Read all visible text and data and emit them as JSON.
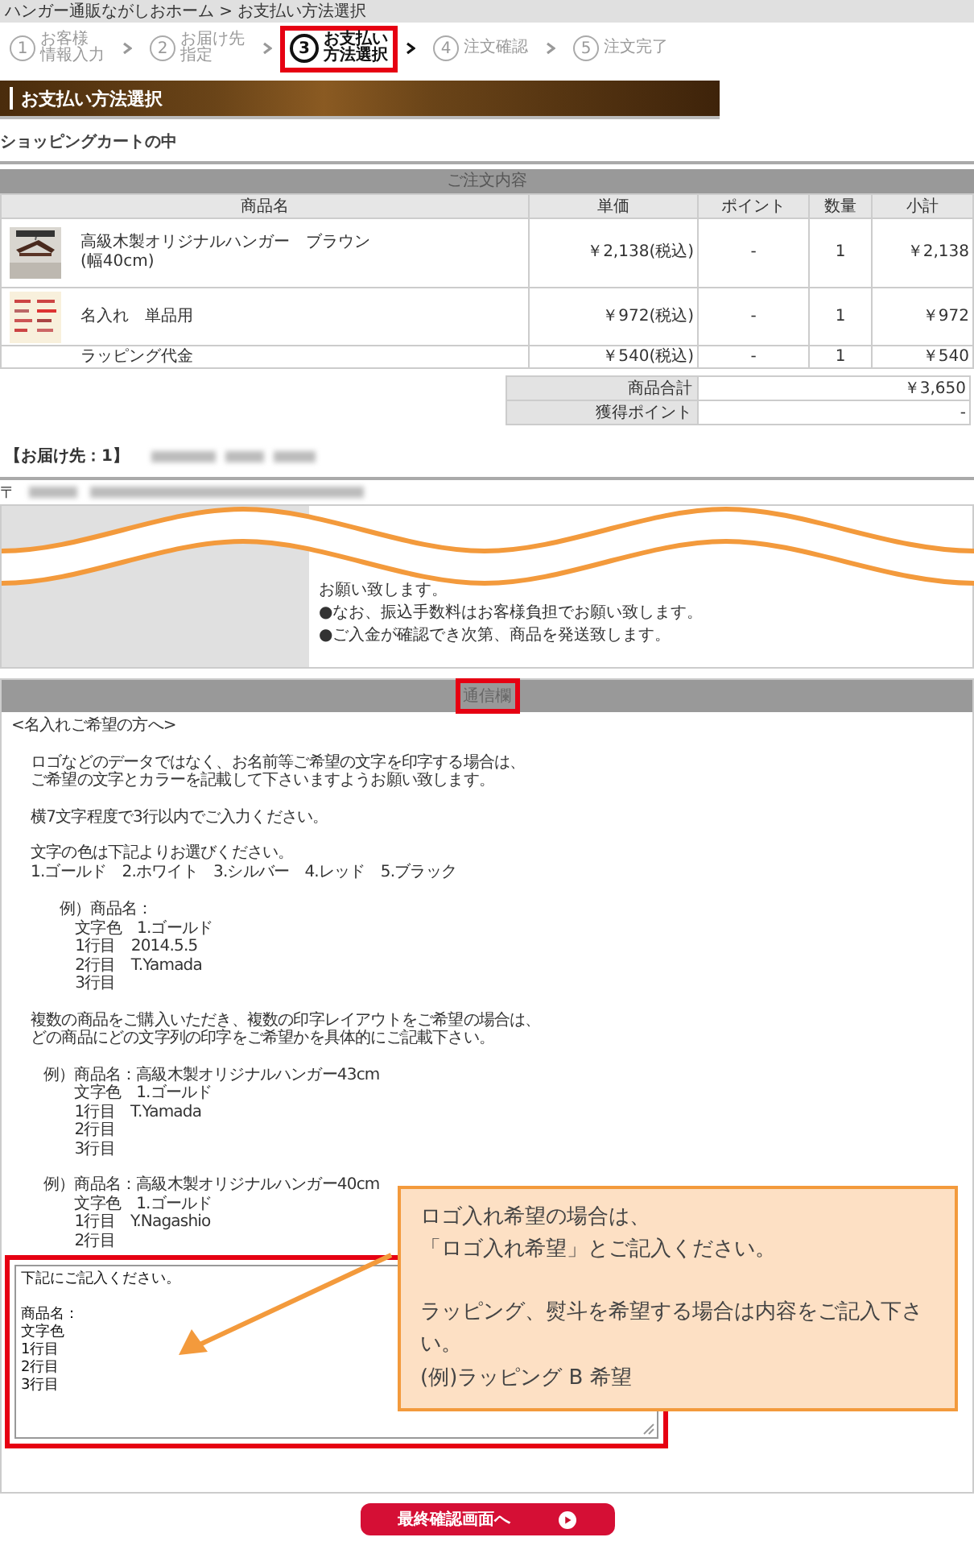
{
  "breadcrumb": "ハンガー通販ながしおホーム > お支払い方法選択",
  "steps": [
    {
      "num": "1",
      "lines": [
        "お客様",
        "情報入力"
      ],
      "selected": false
    },
    {
      "num": "2",
      "lines": [
        "お届け先",
        "指定"
      ],
      "selected": false
    },
    {
      "num": "3",
      "lines": [
        "お支払い",
        "方法選択"
      ],
      "selected": true
    },
    {
      "num": "4",
      "lines": [
        "注文確認"
      ],
      "selected": false
    },
    {
      "num": "5",
      "lines": [
        "注文完了"
      ],
      "selected": false
    }
  ],
  "page_heading": "お支払い方法選択",
  "cart_title": "ショッピングカートの中",
  "order": {
    "caption": "ご注文内容",
    "columns": [
      "商品名",
      "単価",
      "ポイント",
      "数量",
      "小計"
    ],
    "rows": [
      {
        "name": "高級木製オリジナルハンガー　ブラウン",
        "note": "(幅40cm)",
        "price": "￥2,138(税込)",
        "points": "-",
        "qty": "1",
        "subtotal": "￥2,138"
      },
      {
        "kind": "sample",
        "name": "名入れ　単品用",
        "price": "￥972(税込)",
        "points": "-",
        "qty": "1",
        "subtotal": "￥972"
      },
      {
        "kind": "plain",
        "name": "ラッピング代金",
        "price": "￥540(税込)",
        "points": "-",
        "qty": "1",
        "subtotal": "￥540"
      }
    ],
    "summary": [
      {
        "label": "商品合計",
        "value": "￥3,650"
      },
      {
        "label": "獲得ポイント",
        "value": "-"
      }
    ]
  },
  "delivery": {
    "label": "【お届け先：1】",
    "postal_mark": "〒"
  },
  "payment_notes": [
    "お願い致します。",
    "●なお、振込手数料はお客様負担でお願い致します。",
    "●ご入金が確認でき次第、商品を発送致します。"
  ],
  "message": {
    "caption": "通信欄",
    "caption_highlighted": true,
    "paragraphs": [
      {
        "kind": "title",
        "lines": [
          "<名入れご希望の方へ>"
        ]
      },
      {
        "kind": "body",
        "lines": [
          "ロゴなどのデータではなく、お名前等ご希望の文字を印字する場合は、",
          "ご希望の文字とカラーを記載して下さいますようお願い致します。"
        ]
      },
      {
        "kind": "body",
        "lines": [
          "横7文字程度で3行以内でご入力ください。"
        ]
      },
      {
        "kind": "body",
        "lines": [
          "文字の色は下記よりお選びください。",
          "1.ゴールド　2.ホワイト　3.シルバー　4.レッド　5.ブラック"
        ]
      },
      {
        "kind": "example_wide",
        "lines": [
          "例）商品名：",
          "　文字色　1.ゴールド",
          "　1行目　2014.5.5",
          "　2行目　T.Yamada",
          "　3行目"
        ]
      },
      {
        "kind": "body",
        "lines": [
          "複数の商品をご購入いただき、複数の印字レイアウトをご希望の場合は、",
          "どの商品にどの文字列の印字をご希望かを具体的にご記載下さい。"
        ]
      },
      {
        "kind": "example",
        "lines": [
          "例）商品名：高級木製オリジナルハンガー43cm",
          "　　文字色　1.ゴールド",
          "　　1行目　T.Yamada",
          "　　2行目",
          "　　3行目"
        ]
      },
      {
        "kind": "example",
        "lines": [
          "例）商品名：高級木製オリジナルハンガー40cm",
          "　　文字色　1.ゴールド",
          "　　1行目　Y.Nagashio",
          "　　2行目"
        ]
      }
    ],
    "input_paragraphs": [
      [
        "下記にご記入ください。"
      ],
      [
        "商品名：",
        "文字色",
        "1行目",
        "2行目",
        "3行目"
      ]
    ],
    "input_highlighted": true
  },
  "callout": [
    [
      "ロゴ入れ希望の場合は、",
      "「ロゴ入れ希望」とご記入ください。"
    ],
    [
      "ラッピング、熨斗を希望する場合は内容をご記入下さい。",
      "(例)ラッピング B 希望"
    ]
  ],
  "next_button": "最終確認画面へ"
}
